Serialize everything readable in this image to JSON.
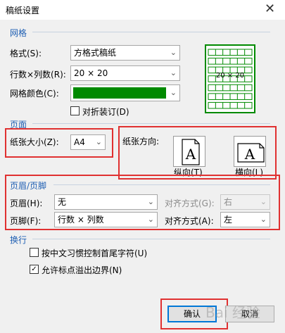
{
  "window": {
    "title": "稿纸设置",
    "close_glyph": "✕"
  },
  "grid_section": {
    "title": "网格",
    "format_label": "格式(S):",
    "format_value": "方格式稿纸",
    "rows_cols_label": "行数×列数(R):",
    "rows_cols_value": "20 × 20",
    "color_label": "网格颜色(C):",
    "color_value": "#008a00",
    "fold_label": "对折装订(D)",
    "fold_checked": false,
    "preview_label": "20 × 20",
    "preview_color": "#008a00"
  },
  "page_section": {
    "title": "页面",
    "paper_size_label": "纸张大小(Z):",
    "paper_size_value": "A4",
    "orientation_label": "纸张方向:",
    "portrait_label": "纵向(T)",
    "landscape_label": "横向(L)"
  },
  "header_footer_section": {
    "title": "页眉/页脚",
    "header_label": "页眉(H):",
    "header_value": "无",
    "header_align_label": "对齐方式(G):",
    "header_align_value": "右",
    "footer_label": "页脚(F):",
    "footer_value": "行数 × 列数",
    "footer_align_label": "对齐方式(A):",
    "footer_align_value": "左"
  },
  "wrap_section": {
    "title": "换行",
    "opt1_label": "按中文习惯控制首尾字符(U)",
    "opt1_checked": false,
    "opt2_label": "允许标点溢出边界(N)",
    "opt2_checked": true
  },
  "buttons": {
    "ok": "确认",
    "cancel": "取消"
  },
  "icons": {
    "chevron": "chevron-down-icon",
    "check": "✓"
  },
  "colors": {
    "accent": "#1f5fb3",
    "highlight_red": "#e03131",
    "focus_blue": "#0078d7"
  },
  "watermark": "Bai 经验"
}
